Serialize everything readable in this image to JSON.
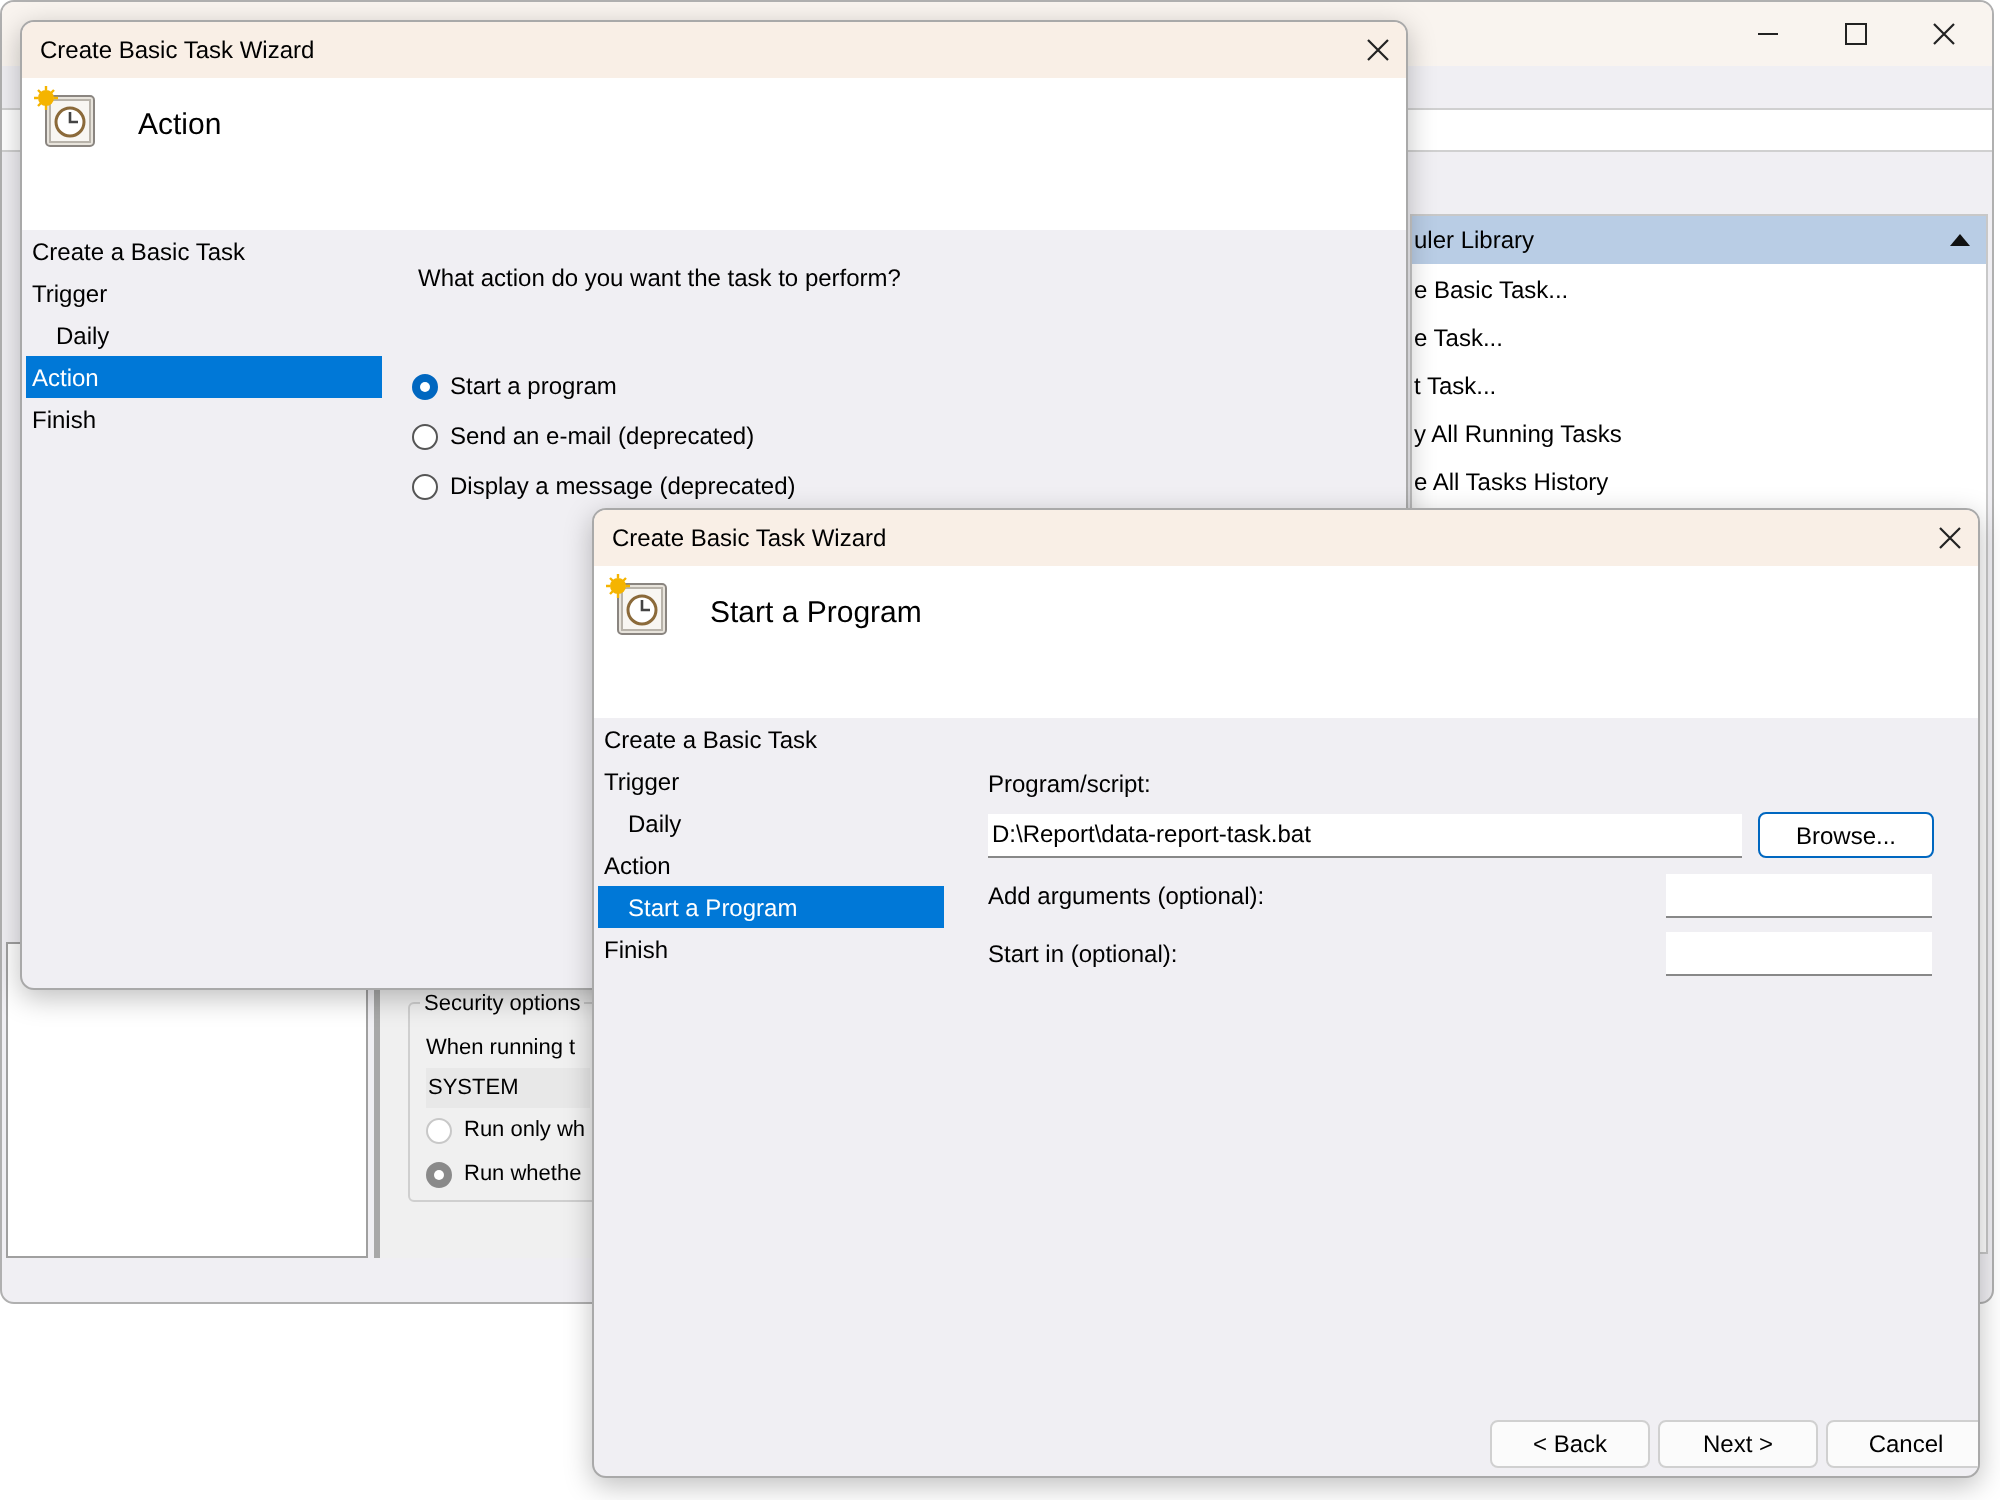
{
  "main_window": {
    "actions_panel": {
      "header": "uler Library",
      "expanded": true,
      "items": [
        "e Basic Task...",
        "e Task...",
        "t Task...",
        "y All Running Tasks",
        "e All Tasks History"
      ]
    },
    "security_options": {
      "title": "Security options",
      "prompt": "When running t",
      "account": "SYSTEM",
      "options": [
        {
          "label": "Run only wh",
          "selected": false
        },
        {
          "label": "Run whethe",
          "selected": true
        }
      ]
    }
  },
  "wizards": [
    {
      "title": "Create Basic Task Wizard",
      "heading": "Action",
      "nav": [
        {
          "label": "Create a Basic Task",
          "selected": false
        },
        {
          "label": "Trigger",
          "selected": false,
          "children": [
            {
              "label": "Daily",
              "selected": false
            }
          ]
        },
        {
          "label": "Action",
          "selected": true
        },
        {
          "label": "Finish",
          "selected": false
        }
      ],
      "content": {
        "kind": "choice",
        "question": "What action do you want the task to perform?",
        "options": [
          {
            "label": "Start a program",
            "selected": true
          },
          {
            "label": "Send an e-mail (deprecated)",
            "selected": false
          },
          {
            "label": "Display a message (deprecated)",
            "selected": false
          }
        ]
      }
    },
    {
      "title": "Create Basic Task Wizard",
      "heading": "Start a Program",
      "nav": [
        {
          "label": "Create a Basic Task",
          "selected": false
        },
        {
          "label": "Trigger",
          "selected": false,
          "children": [
            {
              "label": "Daily",
              "selected": false
            }
          ]
        },
        {
          "label": "Action",
          "selected": false,
          "children": [
            {
              "label": "Start a Program",
              "selected": true
            }
          ]
        },
        {
          "label": "Finish",
          "selected": false
        }
      ],
      "content": {
        "kind": "program",
        "program_label": "Program/script:",
        "program_value": "D:\\Report\\data-report-task.bat",
        "browse": "Browse...",
        "arguments_label": "Add arguments (optional):",
        "start_in_label": "Start in (optional):"
      },
      "buttons": [
        "< Back",
        "Next >",
        "Cancel"
      ]
    }
  ]
}
